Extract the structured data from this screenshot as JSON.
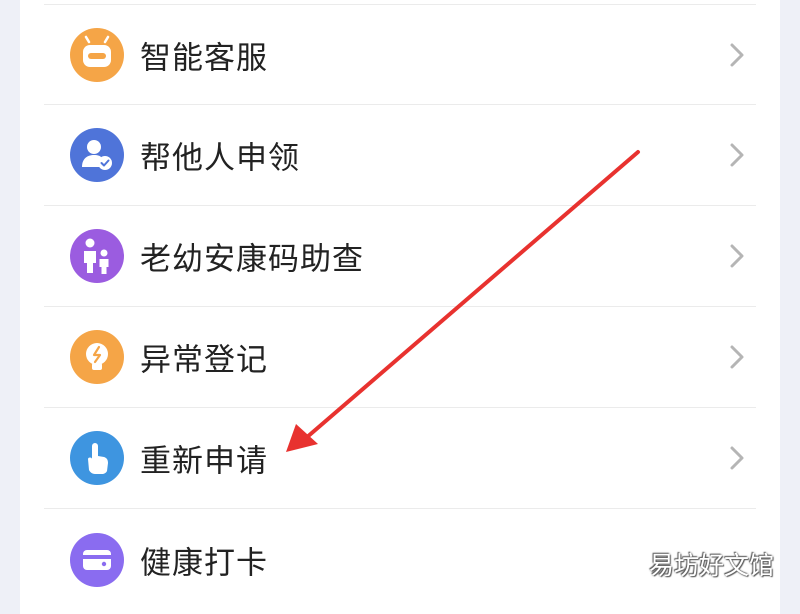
{
  "menu": {
    "items": [
      {
        "label": "智能客服",
        "icon": "robot-icon",
        "color": "#f5a547"
      },
      {
        "label": "帮他人申领",
        "icon": "person-check-icon",
        "color": "#4f74d9"
      },
      {
        "label": "老幼安康码助查",
        "icon": "family-icon",
        "color": "#9b5ce0"
      },
      {
        "label": "异常登记",
        "icon": "lightbulb-icon",
        "color": "#f5a547"
      },
      {
        "label": "重新申请",
        "icon": "touch-hand-icon",
        "color": "#3e95e0"
      },
      {
        "label": "健康打卡",
        "icon": "card-icon",
        "color": "#8a6cf0"
      }
    ]
  },
  "overlay": {
    "arrow_color": "#e8322f",
    "watermark": "易坊好文馆"
  }
}
